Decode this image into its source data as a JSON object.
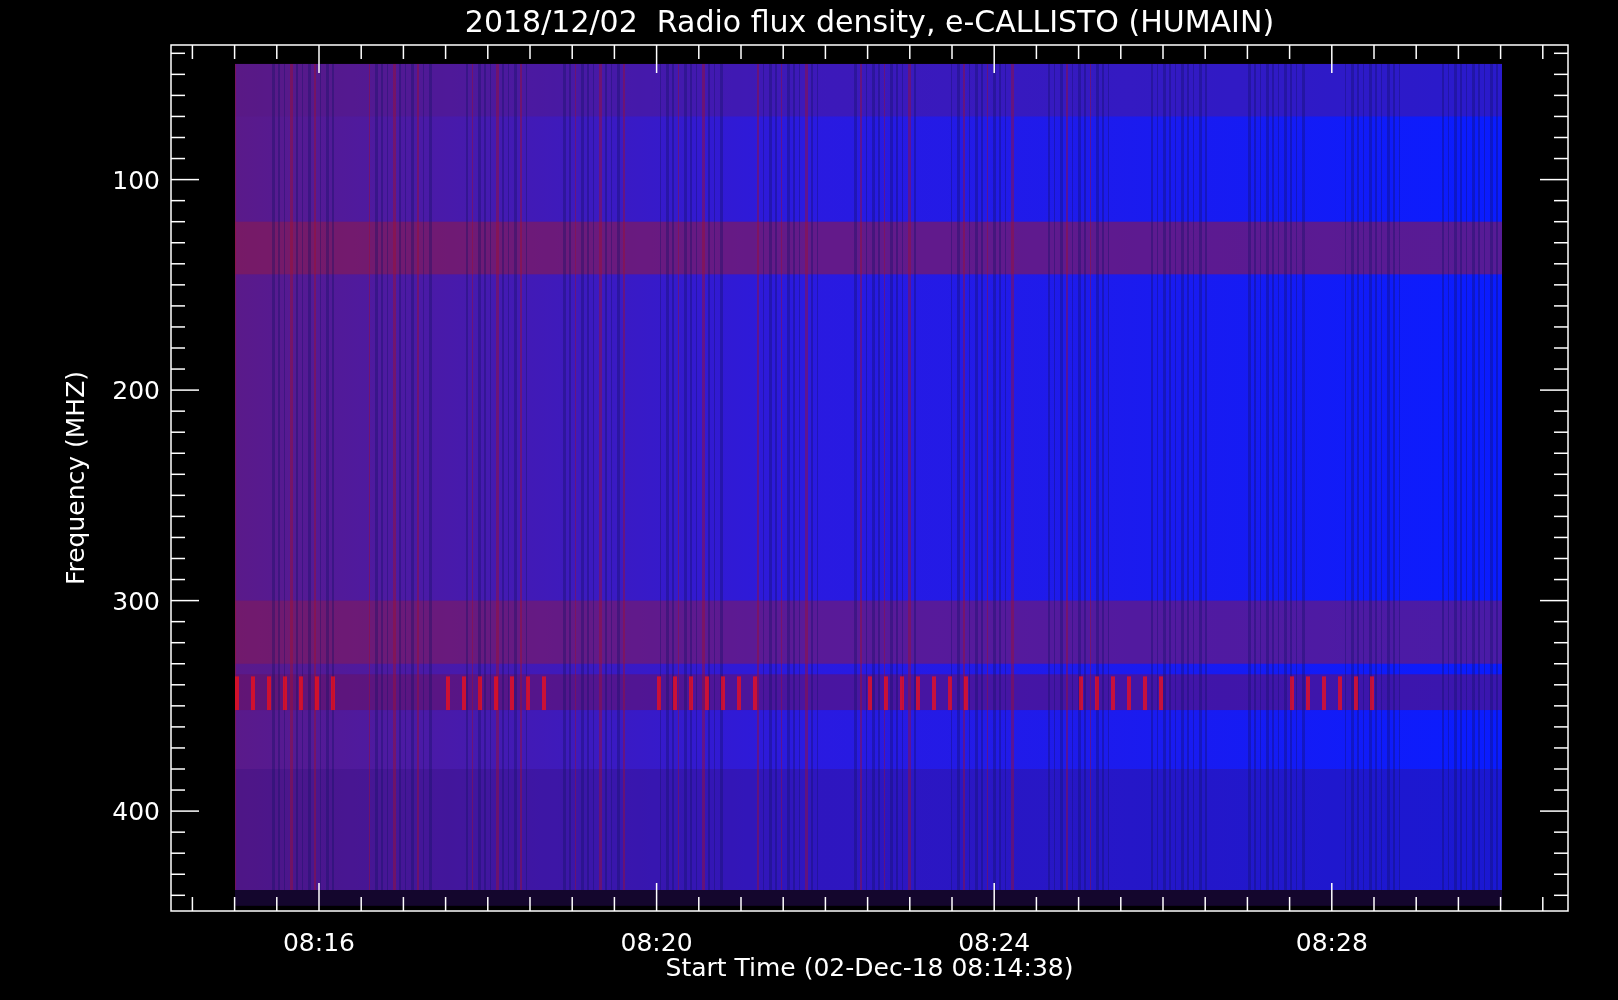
{
  "title": "2018/12/02  Radio flux density, e-CALLISTO (HUMAIN)",
  "y_axis": {
    "label": "Frequency (MHZ)",
    "ticks": [
      "100",
      "200",
      "300",
      "400"
    ]
  },
  "x_axis": {
    "label": "Start Time (02-Dec-18 08:14:38)",
    "ticks": [
      "08:16",
      "08:20",
      "08:24",
      "08:28"
    ]
  }
}
